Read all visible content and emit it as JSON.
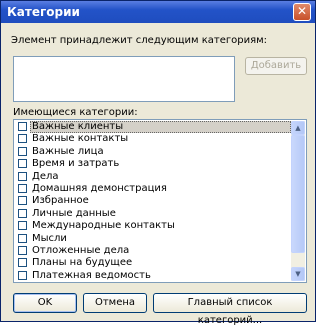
{
  "window": {
    "title": "Категории",
    "close_label": "✕"
  },
  "dialog": {
    "prompt_label": "Элемент принадлежит следующим категориям:",
    "input_value": "",
    "add_button": "Добавить",
    "list_label": "Имеющиеся категории:",
    "categories": [
      {
        "label": "Важные клиенты",
        "checked": false,
        "selected": true
      },
      {
        "label": "Важные контакты",
        "checked": false,
        "selected": false
      },
      {
        "label": "Важные лица",
        "checked": false,
        "selected": false
      },
      {
        "label": "Время и затрать",
        "checked": false,
        "selected": false
      },
      {
        "label": "Дела",
        "checked": false,
        "selected": false
      },
      {
        "label": "Домашняя демонстрация",
        "checked": false,
        "selected": false
      },
      {
        "label": "Избранное",
        "checked": false,
        "selected": false
      },
      {
        "label": "Личные данные",
        "checked": false,
        "selected": false
      },
      {
        "label": "Международные контакты",
        "checked": false,
        "selected": false
      },
      {
        "label": "Мысли",
        "checked": false,
        "selected": false
      },
      {
        "label": "Отложенные дела",
        "checked": false,
        "selected": false
      },
      {
        "label": "Планы на будущее",
        "checked": false,
        "selected": false
      },
      {
        "label": "Платежная ведомость",
        "checked": false,
        "selected": false
      }
    ]
  },
  "buttons": {
    "ok": "OK",
    "cancel": "Отмена",
    "master_list": "Главный список категорий..."
  },
  "colors": {
    "title_bar": "#2353c8",
    "dialog_bg": "#ece9d8",
    "selection": "#d4d0c8"
  }
}
